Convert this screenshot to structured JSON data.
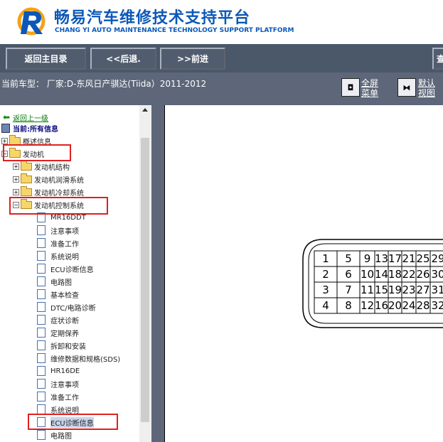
{
  "header": {
    "title_cn": "畅易汽车维修技术支持平台",
    "title_en": "CHANG YI AUTO MAINTENANCE TECHNOLOGY SUPPORT PLATFORM",
    "accent": "#0b58b8"
  },
  "toolbar": {
    "back_main": "返回主目录",
    "prev": "<<后退.",
    "next": ">>前进",
    "right_partial": "查"
  },
  "infobar": {
    "vehicle": "当前车型：  厂家:D-东风日产骐达(Tiida）2011-2012",
    "full_menu": "全屏菜单",
    "default_view": "默认视图"
  },
  "tree": {
    "back": "返回上一级",
    "current": "当前:所有信息",
    "overview": "概述信息",
    "engine": "发动机",
    "engine_structure": "发动机结构",
    "engine_lube": "发动机润滑系统",
    "engine_cooling": "发动机冷却系统",
    "engine_control": "发动机控制系统",
    "items": [
      "MR16DDT",
      "注意事项",
      "准备工作",
      "系统说明",
      "ECU诊断信息",
      "电路图",
      "基本检查",
      "DTC/电路诊断",
      "症状诊断",
      "定期保养",
      "拆卸和安装",
      "维修数据和规格(SDS)",
      "HR16DE",
      "注意事项",
      "准备工作",
      "系统说明",
      "ECU诊断信息",
      "电路图"
    ]
  },
  "connector": {
    "rows": [
      [
        "1",
        "5",
        "9",
        "13",
        "17",
        "21",
        "25",
        "29"
      ],
      [
        "2",
        "6",
        "10",
        "14",
        "18",
        "22",
        "26",
        "30"
      ],
      [
        "3",
        "7",
        "11",
        "15",
        "19",
        "23",
        "27",
        "31"
      ],
      [
        "4",
        "8",
        "12",
        "16",
        "20",
        "24",
        "28",
        "32"
      ]
    ]
  }
}
